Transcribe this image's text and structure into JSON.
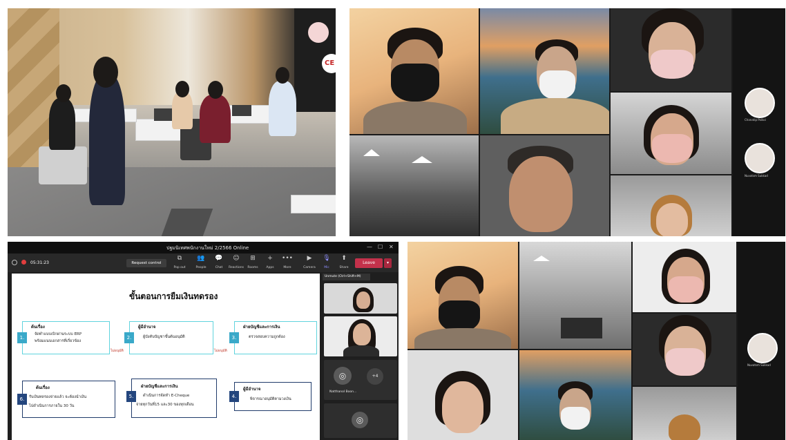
{
  "colors": {
    "teams_bg": "#1f1f1f",
    "leave_red": "#c4314b",
    "step_teal": "#5fd3dd",
    "step_navy": "#1f3a6a",
    "step_num_teal": "#3aa9c9",
    "step_num_navy": "#24467e"
  },
  "teams": {
    "window_title": "ปฐมนิเทศพนักงานใหม่ 2/2566 Online",
    "window_controls": {
      "minimize": "—",
      "maximize": "☐",
      "close": "✕"
    },
    "timer": "05:31:23",
    "request_control": "Request control",
    "toolbar_items": [
      {
        "icon": "pop-out-icon",
        "glyph": "⧉",
        "label": "Pop out"
      },
      {
        "icon": "people-icon",
        "glyph": "👥",
        "label": "People"
      },
      {
        "icon": "chat-icon",
        "glyph": "💬",
        "label": "Chat"
      },
      {
        "icon": "reactions-icon",
        "glyph": "☺",
        "label": "Reactions"
      },
      {
        "icon": "rooms-icon",
        "glyph": "⊞",
        "label": "Rooms"
      },
      {
        "icon": "apps-icon",
        "glyph": "+",
        "label": "Apps"
      },
      {
        "icon": "more-icon",
        "glyph": "•••",
        "label": "More"
      },
      {
        "icon": "camera-icon",
        "glyph": "▶",
        "label": "Camera"
      },
      {
        "icon": "mic-icon",
        "glyph": "🎙",
        "label": "Mic"
      },
      {
        "icon": "share-icon",
        "glyph": "⬆",
        "label": "Share"
      }
    ],
    "leave_label": "Leave",
    "unmute_tooltip": "Unmute (Ctrl+Shift+M)",
    "more_participants": "+4",
    "participant_name": "Natthanol Boon..."
  },
  "slide": {
    "title": "ขั้นตอนการยืมเงินทดรอง",
    "steps": [
      {
        "num": "1.",
        "head": "ต้นเรื่อง",
        "lines": [
          "จัดทำแบบเบิกผ่านระบบ ERP",
          "พร้อมแนบเอกสารที่เกี่ยวข้อง"
        ]
      },
      {
        "num": "2.",
        "head": "ผู้มีอำนาจ",
        "lines": [
          "ผู้บังคับบัญชาขั้นต้นอนุมัติ"
        ]
      },
      {
        "num": "3.",
        "head": "ฝ่ายบัญชีและการเงิน",
        "lines": [
          "ตรวจสอบความถูกต้อง"
        ]
      },
      {
        "num": "4.",
        "head": "ผู้มีอำนาจ",
        "lines": [
          "พิจารณาอนุมัติตามวงเงิน"
        ]
      },
      {
        "num": "5.",
        "head": "ฝ่ายบัญชีและการเงิน",
        "lines": [
          "ดำเนินการจัดทำ E-Cheque",
          "จ่ายทุกวันที่15 และ30 ของทุกเดือน"
        ]
      },
      {
        "num": "6.",
        "head": "ต้นเรื่อง",
        "lines": [
          "รับเงินทดรองจ่ายแล้ว จะต้องนำเงิน",
          "ไปดำเนินการภายใน 30 วัน"
        ]
      }
    ],
    "not_approved_1": "ไม่อนุมัติ",
    "not_approved_2": "ไม่อนุมัติ"
  },
  "sidebar_names": {
    "top_first": "Chanatip Poikoi",
    "top_second": "Nuvatsm Sukkad",
    "bottom": "Nuvatsm Sukkad"
  }
}
